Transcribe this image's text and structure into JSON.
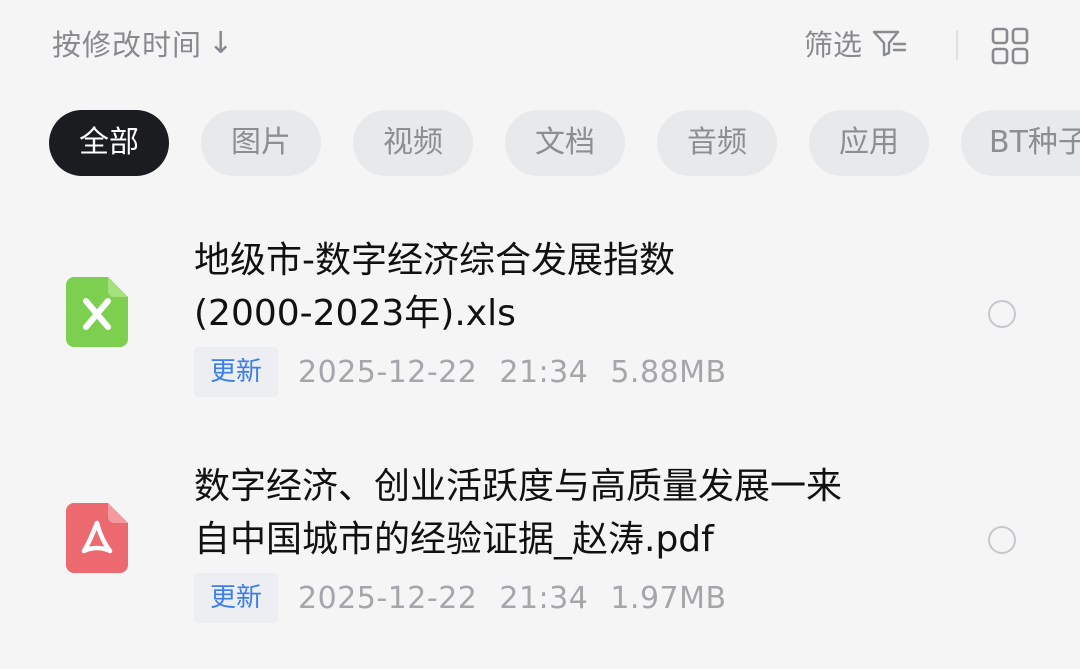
{
  "header": {
    "sort_label": "按修改时间",
    "sort_arrow": "↓",
    "filter_label": "筛选",
    "filter_icon": "filter-icon",
    "view_icon": "grid-view-icon"
  },
  "tabs": [
    {
      "label": "全部",
      "active": true
    },
    {
      "label": "图片",
      "active": false
    },
    {
      "label": "视频",
      "active": false
    },
    {
      "label": "文档",
      "active": false
    },
    {
      "label": "音频",
      "active": false
    },
    {
      "label": "应用",
      "active": false
    },
    {
      "label": "BT种子",
      "active": false
    }
  ],
  "files": [
    {
      "name_line1": "地级市-数字经济综合发展指数",
      "name_line2": "(2000-2023年).xls",
      "icon": "excel-file-icon",
      "icon_color": "#7ccf4f",
      "badge": "更新",
      "date": "2025-12-22",
      "time": "21:34",
      "size": "5.88MB"
    },
    {
      "name_line1": "数字经济、创业活跃度与高质量发展一来",
      "name_line2": "自中国城市的经验证据_赵涛.pdf",
      "icon": "pdf-file-icon",
      "icon_color": "#ec6a6f",
      "badge": "更新",
      "date": "2025-12-22",
      "time": "21:34",
      "size": "1.97MB"
    }
  ],
  "colors": {
    "background": "#f5f5f6",
    "active_tab": "#1a1c20",
    "inactive_tab": "#e8e9eb",
    "badge_text": "#3d7ee8"
  }
}
